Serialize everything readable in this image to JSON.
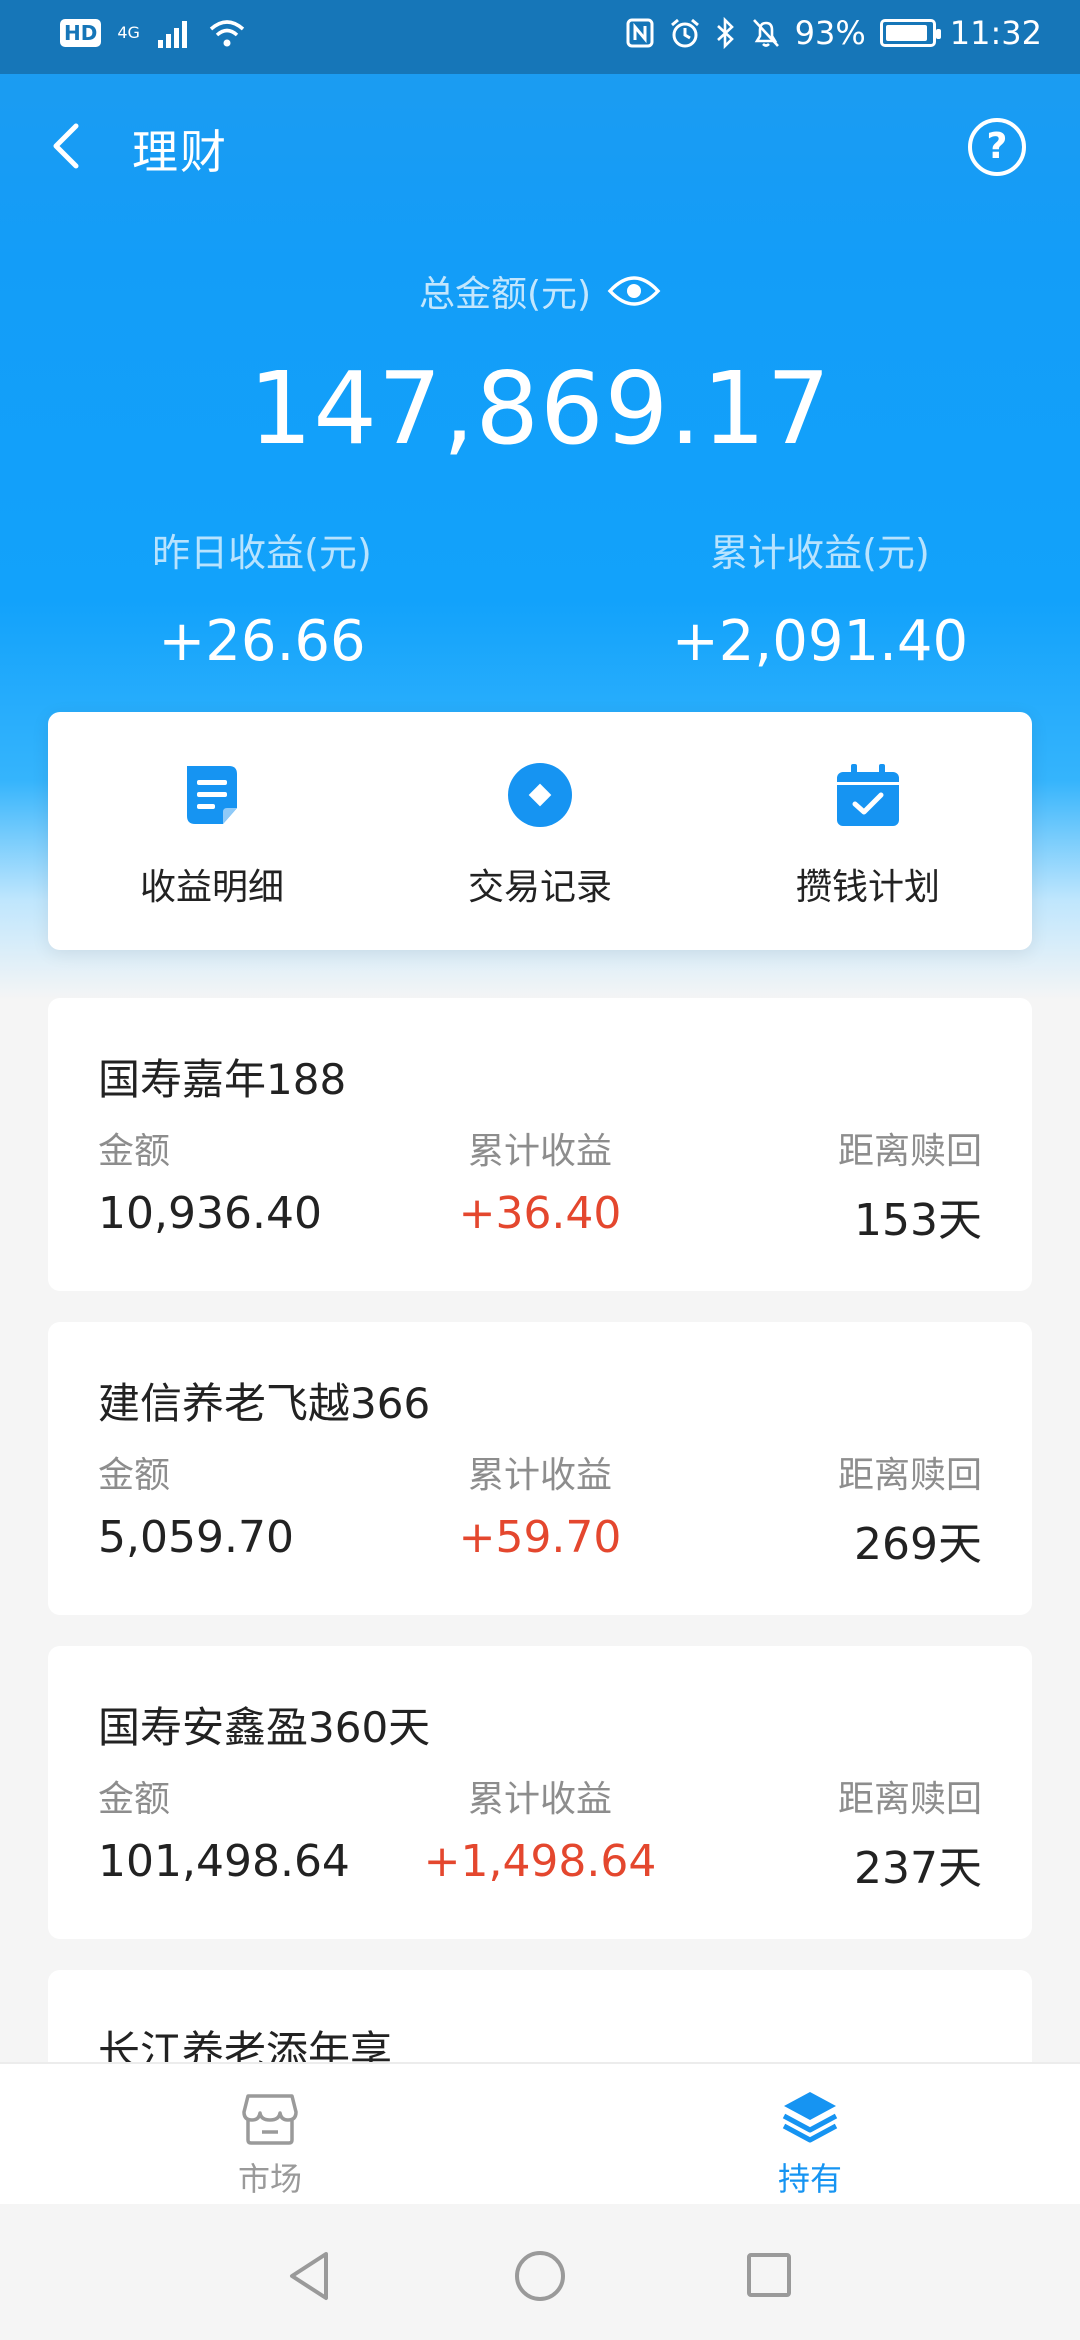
{
  "status_bar": {
    "hd": "HD",
    "network": "4G",
    "battery": "93%",
    "time": "11:32"
  },
  "header": {
    "title": "理财"
  },
  "summary": {
    "total_label": "总金额(元)",
    "total_value": "147,869.17",
    "yesterday_label": "昨日收益(元)",
    "yesterday_value": "+26.66",
    "cumulative_label": "累计收益(元)",
    "cumulative_value": "+2,091.40"
  },
  "actions": [
    {
      "label": "收益明细",
      "icon": "document-icon"
    },
    {
      "label": "交易记录",
      "icon": "record-icon"
    },
    {
      "label": "攒钱计划",
      "icon": "calendar-check-icon"
    }
  ],
  "holdings_columns": {
    "amount": "金额",
    "profit": "累计收益",
    "redeem": "距离赎回"
  },
  "holdings": [
    {
      "name": "国寿嘉年188",
      "amount": "10,936.40",
      "profit": "+36.40",
      "days": "153天"
    },
    {
      "name": "建信养老飞越366",
      "amount": "5,059.70",
      "profit": "+59.70",
      "days": "269天"
    },
    {
      "name": "国寿安鑫盈360天",
      "amount": "101,498.64",
      "profit": "+1,498.64",
      "days": "237天"
    },
    {
      "name": "长江养老添年享"
    }
  ],
  "tabs": [
    {
      "label": "市场",
      "icon": "storefront-icon",
      "active": false
    },
    {
      "label": "持有",
      "icon": "layers-icon",
      "active": true
    }
  ],
  "colors": {
    "accent": "#1694f2",
    "profit": "#e4472e",
    "header": "#12a2fb"
  }
}
